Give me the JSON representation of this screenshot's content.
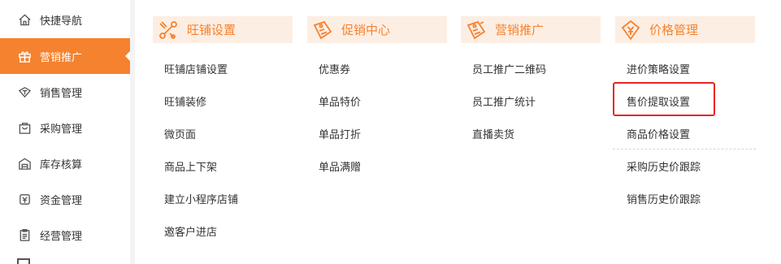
{
  "sidebar": {
    "items": [
      {
        "label": "快捷导航",
        "icon": "home-icon"
      },
      {
        "label": "营销推广",
        "icon": "gift-icon",
        "active": true
      },
      {
        "label": "销售管理",
        "icon": "sales-icon"
      },
      {
        "label": "采购管理",
        "icon": "shopping-bag-icon"
      },
      {
        "label": "库存核算",
        "icon": "warehouse-icon"
      },
      {
        "label": "资金管理",
        "icon": "money-icon"
      },
      {
        "label": "经营管理",
        "icon": "clipboard-icon"
      }
    ]
  },
  "columns": [
    {
      "title": "旺铺设置",
      "icon": "shop-tools-icon",
      "items": [
        "旺铺店铺设置",
        "旺铺装修",
        "微页面",
        "商品上下架",
        "建立小程序店铺",
        "邀客户进店"
      ]
    },
    {
      "title": "促销中心",
      "icon": "promotion-tag-icon",
      "items": [
        "优惠券",
        "单品特价",
        "单品打折",
        "单品满赠"
      ]
    },
    {
      "title": "营销推广",
      "icon": "marketing-tag-icon",
      "items": [
        "员工推广二维码",
        "员工推广统计",
        "直播卖货"
      ]
    },
    {
      "title": "价格管理",
      "icon": "price-tag-icon",
      "items": [
        "进价策略设置",
        "售价提取设置",
        "商品价格设置",
        "采购历史价跟踪",
        "销售历史价跟踪"
      ]
    }
  ],
  "colors": {
    "accent": "#f5822f",
    "header_bg": "#fdeee3",
    "highlight": "#e82525"
  }
}
